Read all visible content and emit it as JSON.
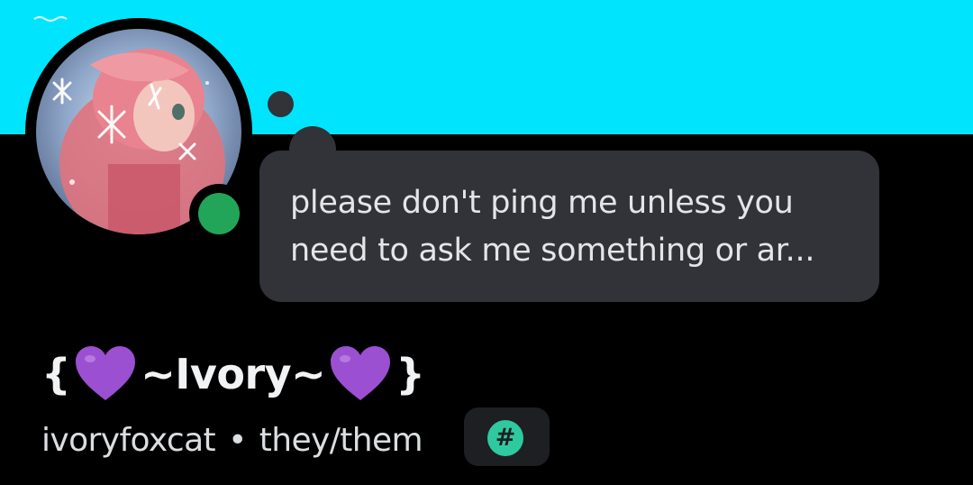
{
  "colors": {
    "banner": "#00e5fd",
    "background": "#000000",
    "bubble": "#313338",
    "status_online": "#23a559",
    "badge_bg": "#1e1f22",
    "badge_icon": "#2fc9a0",
    "heart": "#9b4fd1"
  },
  "profile": {
    "avatar_icon": "avatar-image",
    "status": "online",
    "custom_status": {
      "line1": "please don't ping me unless you",
      "line2": "need to ask me something or ar..."
    },
    "display_name": {
      "open": "{",
      "emoji_left": "purple-heart-emoji",
      "name": "~Ivory~",
      "emoji_right": "purple-heart-emoji",
      "close": "}"
    },
    "username": "ivoryfoxcat",
    "separator": "•",
    "pronouns": "they/them",
    "badge": {
      "glyph": "#",
      "icon": "hashtag-badge-icon"
    }
  }
}
